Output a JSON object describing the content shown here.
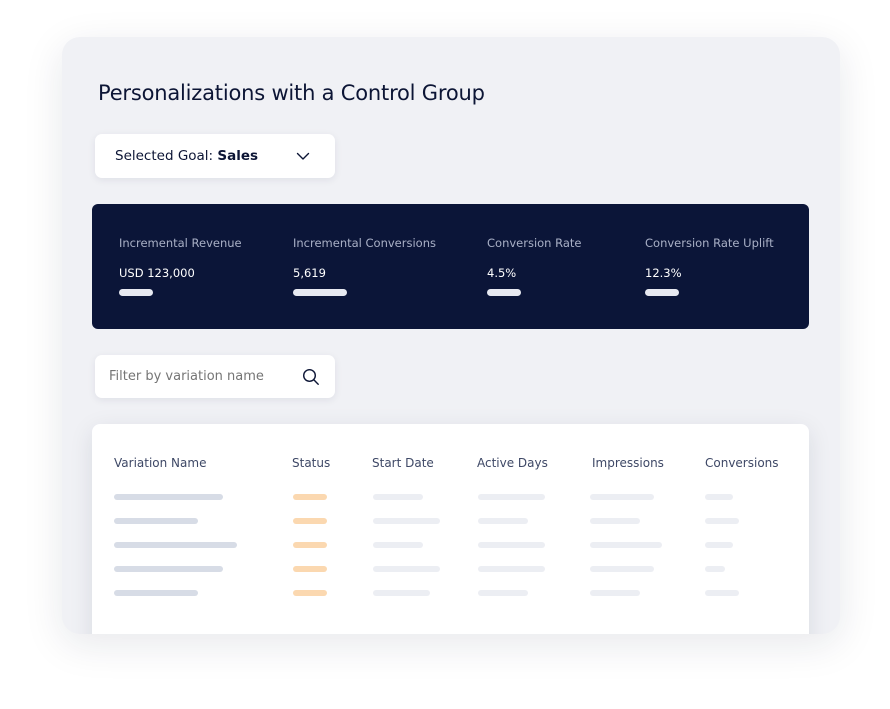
{
  "page": {
    "title": "Personalizations with a Control Group"
  },
  "goal_select": {
    "prefix": "Selected Goal:",
    "value": "Sales",
    "icon": "chevron-down-icon"
  },
  "metrics": [
    {
      "label": "Incremental Revenue",
      "value": "USD 123,000"
    },
    {
      "label": "Incremental Conversions",
      "value": "5,619"
    },
    {
      "label": "Conversion Rate",
      "value": "4.5%"
    },
    {
      "label": "Conversion Rate Uplift",
      "value": "12.3%"
    }
  ],
  "filter": {
    "placeholder": "Filter by variation name",
    "icon": "search-icon"
  },
  "table": {
    "columns": [
      "Variation Name",
      "Status",
      "Start Date",
      "Active Days",
      "Impressions",
      "Conversions"
    ],
    "row_count": 5
  },
  "colors": {
    "card_bg": "#f0f1f5",
    "metrics_bg": "#0b1538",
    "title_text": "#0c1535",
    "status_placeholder": "#fbd8b0",
    "name_placeholder": "#d7dce6",
    "cell_placeholder": "#eceef3"
  }
}
